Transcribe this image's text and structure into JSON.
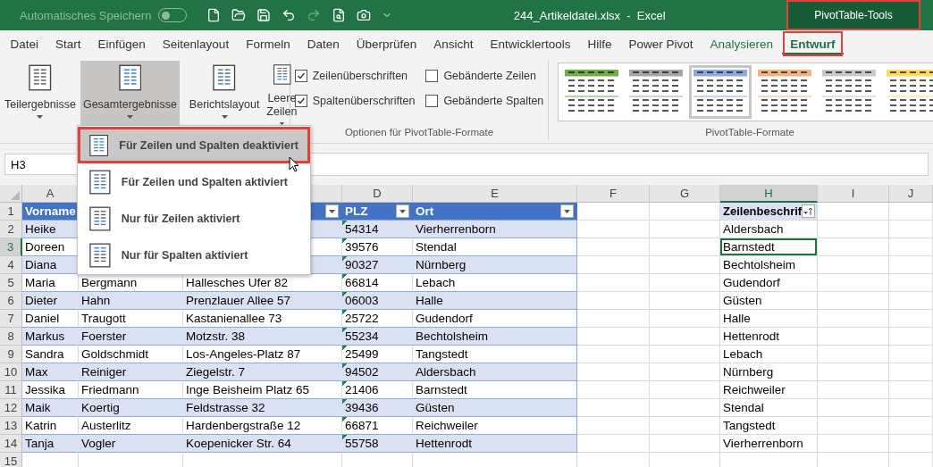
{
  "window": {
    "autosave_label": "Automatisches Speichern",
    "autosave_on": false,
    "title": "244_Artikeldatei.xlsx  -  Excel",
    "context_label": {
      "text": "PivotTable-Tools",
      "highlighted": true
    }
  },
  "tabs": [
    {
      "label": "Datei",
      "selected": false,
      "contextual": false,
      "highlighted": false
    },
    {
      "label": "Start",
      "selected": false,
      "contextual": false,
      "highlighted": false
    },
    {
      "label": "Einfügen",
      "selected": false,
      "contextual": false,
      "highlighted": false
    },
    {
      "label": "Seitenlayout",
      "selected": false,
      "contextual": false,
      "highlighted": false
    },
    {
      "label": "Formeln",
      "selected": false,
      "contextual": false,
      "highlighted": false
    },
    {
      "label": "Daten",
      "selected": false,
      "contextual": false,
      "highlighted": false
    },
    {
      "label": "Überprüfen",
      "selected": false,
      "contextual": false,
      "highlighted": false
    },
    {
      "label": "Ansicht",
      "selected": false,
      "contextual": false,
      "highlighted": false
    },
    {
      "label": "Entwicklertools",
      "selected": false,
      "contextual": false,
      "highlighted": false
    },
    {
      "label": "Hilfe",
      "selected": false,
      "contextual": false,
      "highlighted": false
    },
    {
      "label": "Power Pivot",
      "selected": false,
      "contextual": false,
      "highlighted": false
    },
    {
      "label": "Analysieren",
      "selected": false,
      "contextual": true,
      "highlighted": false
    },
    {
      "label": "Entwurf",
      "selected": true,
      "contextual": true,
      "highlighted": true
    }
  ],
  "ribbon": {
    "layout_buttons": [
      {
        "label": "Teilergebnisse",
        "pressed": false
      },
      {
        "label": "Gesamtergebnisse",
        "pressed": true
      },
      {
        "label": "Berichtslayout",
        "pressed": false
      },
      {
        "label": "Leere Zeilen",
        "pressed": false
      }
    ],
    "options": {
      "label": "Optionen für PivotTable-Formate",
      "checkboxes": [
        {
          "label": "Zeilenüberschriften",
          "checked": true
        },
        {
          "label": "Gebänderte Zeilen",
          "checked": false
        },
        {
          "label": "Spaltenüberschriften",
          "checked": true
        },
        {
          "label": "Gebänderte Spalten",
          "checked": false
        }
      ]
    },
    "styles": {
      "label": "PivotTable-Formate",
      "swatches": [
        {
          "color": "#70ad47",
          "selected": false
        },
        {
          "color": "#a5a5a5",
          "selected": false
        },
        {
          "color": "#8ea9db",
          "selected": true
        },
        {
          "color": "#f4b183",
          "selected": false
        },
        {
          "color": "#c9c9c9",
          "selected": false
        },
        {
          "color": "#ffd966",
          "selected": false
        }
      ]
    }
  },
  "formula_bar": {
    "name_box": "H3"
  },
  "menu": {
    "items": [
      {
        "label": "Für Zeilen und Spalten deaktiviert",
        "selected": true,
        "highlighted": true
      },
      {
        "label": "Für Zeilen und Spalten aktiviert",
        "selected": false,
        "highlighted": false
      },
      {
        "label": "Nur für Zeilen aktiviert",
        "selected": false,
        "highlighted": false
      },
      {
        "label": "Nur für Spalten aktiviert",
        "selected": false,
        "highlighted": false
      }
    ]
  },
  "sheet": {
    "columns": [
      {
        "label": "A",
        "selected": false
      },
      {
        "label": "D",
        "selected": false
      },
      {
        "label": "E",
        "selected": false
      },
      {
        "label": "F",
        "selected": false
      },
      {
        "label": "G",
        "selected": false
      },
      {
        "label": "H",
        "selected": true
      },
      {
        "label": "I",
        "selected": false
      },
      {
        "label": "J",
        "selected": false
      }
    ],
    "row_numbers": [
      {
        "label": "1",
        "selected": false
      },
      {
        "label": "2",
        "selected": false
      },
      {
        "label": "3",
        "selected": true
      },
      {
        "label": "4",
        "selected": false
      },
      {
        "label": "5",
        "selected": false
      },
      {
        "label": "6",
        "selected": false
      },
      {
        "label": "7",
        "selected": false
      },
      {
        "label": "8",
        "selected": false
      },
      {
        "label": "9",
        "selected": false
      },
      {
        "label": "10",
        "selected": false
      },
      {
        "label": "11",
        "selected": false
      },
      {
        "label": "12",
        "selected": false
      },
      {
        "label": "13",
        "selected": false
      },
      {
        "label": "14",
        "selected": false
      },
      {
        "label": "15",
        "selected": false
      }
    ],
    "table": {
      "header": [
        {
          "text": "Vorname",
          "filter": false
        },
        {
          "filter": true
        },
        {
          "text": "PLZ",
          "filter": true
        },
        {
          "text": "Ort",
          "filter": true
        }
      ],
      "rows": [
        {
          "A": "Heike",
          "D": "54314",
          "E": "Vierherrenborn",
          "flagged": true
        },
        {
          "A": "Doreen",
          "D": "39576",
          "E": "Stendal",
          "flagged": true
        },
        {
          "A": "Diana",
          "D": "90327",
          "E": "Nürnberg",
          "flagged": true
        },
        {
          "A": "Maria",
          "B": "Bergmann",
          "C": "Hallesches Ufer 82",
          "D": "66814",
          "E": "Lebach",
          "flagged": true
        },
        {
          "A": "Dieter",
          "B": "Hahn",
          "C": "Prenzlauer Allee 57",
          "D": "06003",
          "E": "Halle",
          "flagged": true
        },
        {
          "A": "Daniel",
          "B": "Traugott",
          "C": "Kastanienallee 73",
          "D": "25722",
          "E": "Gudendorf",
          "flagged": true
        },
        {
          "A": "Markus",
          "B": "Foerster",
          "C": "Motzstr. 38",
          "D": "55234",
          "E": "Bechtolsheim",
          "flagged": true
        },
        {
          "A": "Sandra",
          "B": "Goldschmidt",
          "C": "Los-Angeles-Platz 87",
          "D": "25499",
          "E": "Tangstedt",
          "flagged": true
        },
        {
          "A": "Max",
          "B": "Reiniger",
          "C": "Ziegelstr. 7",
          "D": "94502",
          "E": "Aldersbach",
          "flagged": true
        },
        {
          "A": "Jessika",
          "B": "Friedmann",
          "C": "Inge Beisheim Platz 65",
          "D": "21406",
          "E": "Barnstedt",
          "flagged": true
        },
        {
          "A": "Maik",
          "B": "Koertig",
          "C": "Feldstrasse 32",
          "D": "39436",
          "E": "Güsten",
          "flagged": true
        },
        {
          "A": "Katrin",
          "B": "Austerlitz",
          "C": "Hardenbergstraße 12",
          "D": "66871",
          "E": "Reichweiler",
          "flagged": true
        },
        {
          "A": "Tanja",
          "B": "Vogler",
          "C": "Koepenicker Str. 64",
          "D": "55758",
          "E": "Hettenrodt",
          "flagged": true
        }
      ]
    },
    "pivot": {
      "header": "Zeilenbeschrif",
      "items": [
        {
          "label": "Aldersbach",
          "selected": false
        },
        {
          "label": "Barnstedt",
          "selected": true
        },
        {
          "label": "Bechtolsheim",
          "selected": false
        },
        {
          "label": "Gudendorf",
          "selected": false
        },
        {
          "label": "Güsten",
          "selected": false
        },
        {
          "label": "Halle",
          "selected": false
        },
        {
          "label": "Hettenrodt",
          "selected": false
        },
        {
          "label": "Lebach",
          "selected": false
        },
        {
          "label": "Nürnberg",
          "selected": false
        },
        {
          "label": "Reichweiler",
          "selected": false
        },
        {
          "label": "Stendal",
          "selected": false
        },
        {
          "label": "Tangstedt",
          "selected": false
        },
        {
          "label": "Vierherrenborn",
          "selected": false
        }
      ]
    }
  }
}
